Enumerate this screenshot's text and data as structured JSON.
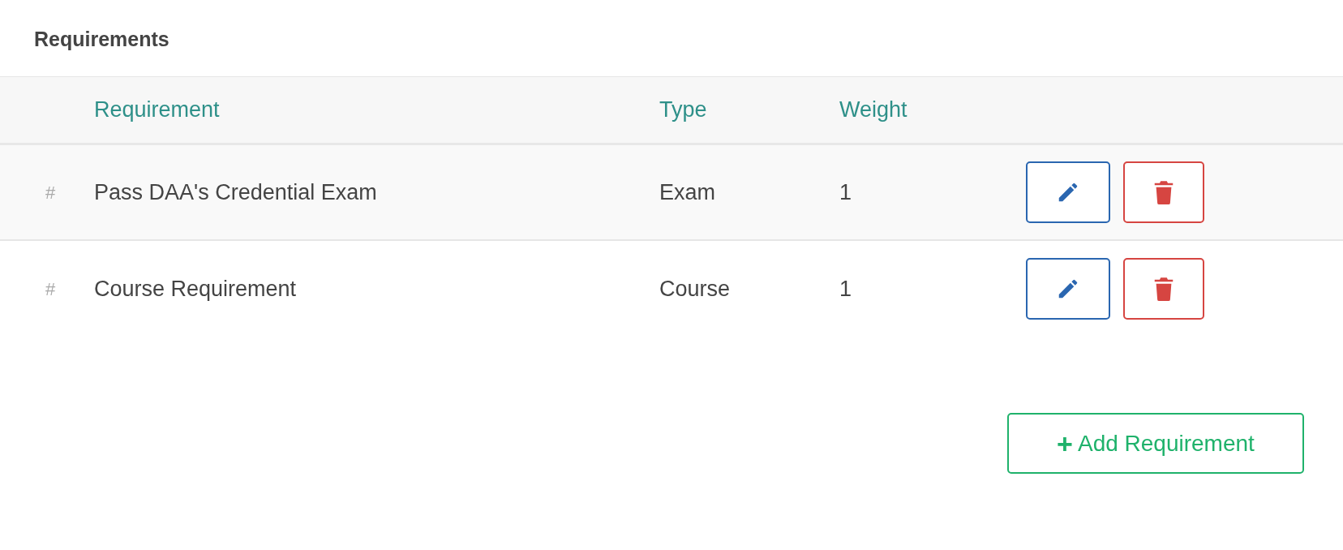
{
  "title": "Requirements",
  "table": {
    "columns": [
      "Requirement",
      "Type",
      "Weight"
    ],
    "rows": [
      {
        "handle": "#",
        "requirement": "Pass DAA's Credential Exam",
        "type": "Exam",
        "weight": "1",
        "highlighted": true
      },
      {
        "handle": "#",
        "requirement": "Course Requirement",
        "type": "Course",
        "weight": "1",
        "highlighted": false
      }
    ]
  },
  "add_button": {
    "icon": "+",
    "label": "Add Requirement"
  }
}
